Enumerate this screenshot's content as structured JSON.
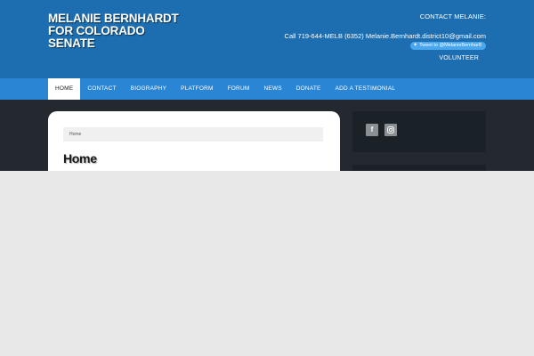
{
  "site": {
    "title": "MELANIE BERNHARDT FOR COLORADO SENATE"
  },
  "contact": {
    "heading": "CONTACT MELANIE:",
    "line": "Call 719-644-MELB (6352) Melanie.Bernhardt.district10@gmail.com",
    "tweet_label": "Tweet to @MelanieBernhar8",
    "volunteer_label": "VOLUNTEER"
  },
  "nav": {
    "items": [
      {
        "label": "HOME",
        "active": true
      },
      {
        "label": "CONTACT"
      },
      {
        "label": "BIOGRAPHY"
      },
      {
        "label": "PLATFORM"
      },
      {
        "label": "FORUM"
      },
      {
        "label": "NEWS"
      },
      {
        "label": "DONATE"
      },
      {
        "label": "ADD A TESTIMONIAL"
      }
    ]
  },
  "main": {
    "breadcrumb": "Home",
    "page_title": "Home"
  },
  "sidebar": {
    "social": [
      {
        "icon": "facebook-icon",
        "glyph": "f"
      },
      {
        "icon": "instagram-icon"
      }
    ]
  },
  "colors": {
    "header_bg": "#1d6eb0",
    "nav_bg": "#2a86d4",
    "dark_band": "#23292e",
    "page_bg": "#e8e8e8"
  }
}
